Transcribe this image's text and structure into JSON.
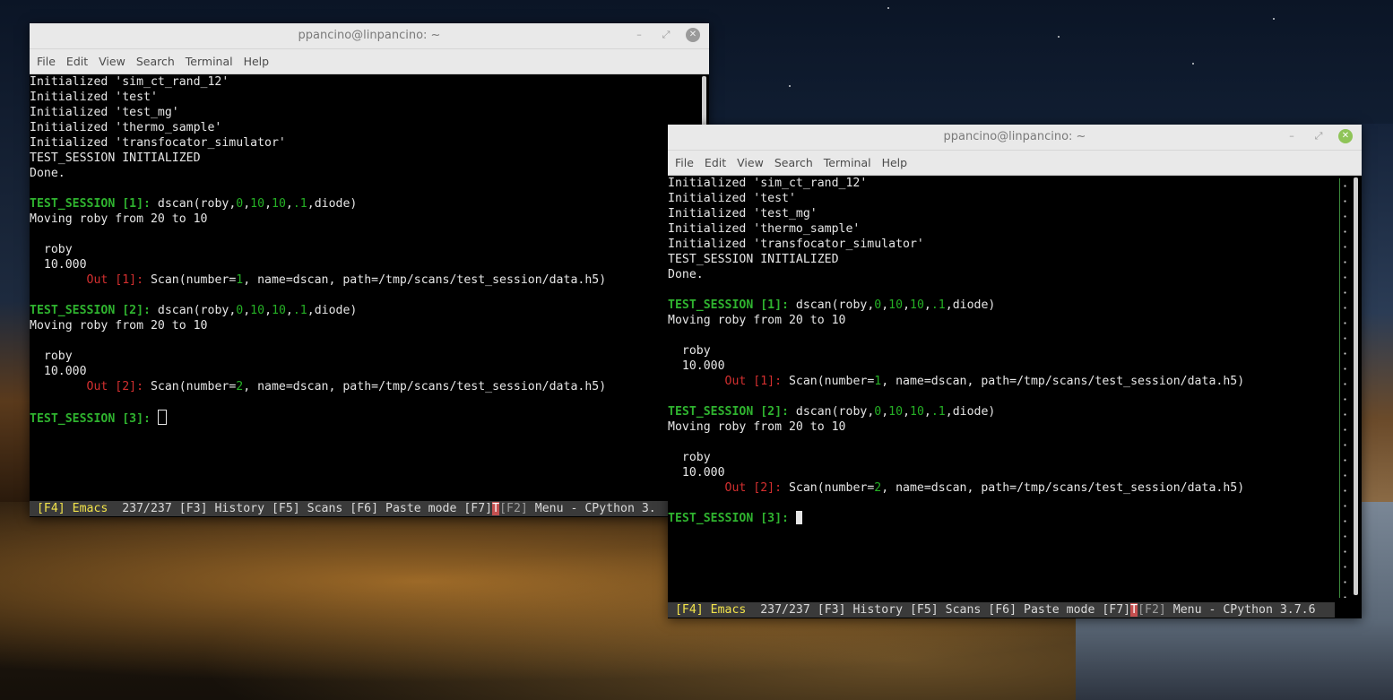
{
  "desktop": {
    "description_icons": []
  },
  "window_left": {
    "title": "ppancino@linpancino: ~",
    "menu": [
      "File",
      "Edit",
      "View",
      "Search",
      "Terminal",
      "Help"
    ],
    "lines": [
      "Initialized 'sim_ct_rand_12'",
      "Initialized 'test'",
      "Initialized 'test_mg'",
      "Initialized 'thermo_sample'",
      "Initialized 'transfocator_simulator'",
      "TEST_SESSION INITIALIZED",
      "Done.",
      "",
      "",
      "Moving roby from 20 to 10",
      "",
      "  roby",
      "  10.000",
      "",
      "",
      "",
      "Moving roby from 20 to 10",
      "",
      "  roby",
      "  10.000",
      "",
      "",
      ""
    ],
    "prompt1": "TEST_SESSION [1]: ",
    "prompt2": "TEST_SESSION [2]: ",
    "prompt3": "TEST_SESSION [3]: ",
    "cmd_pre": "dscan(roby,",
    "cmd_n1": "0",
    "cmd_c1": ",",
    "cmd_n2": "10",
    "cmd_c2": ",",
    "cmd_n3": "10",
    "cmd_c3": ",",
    "cmd_n4": ".1",
    "cmd_post": ",diode)",
    "out1_label": "        Out [1]: ",
    "out2_label": "        Out [2]: ",
    "out_pre": "Scan(number=",
    "out1_num": "1",
    "out2_num": "2",
    "out_post": ", name=dscan, path=/tmp/scans/test_session/data.h5)",
    "status": {
      "f4": "[F4] Emacs",
      "mid": "  237/237 [F3] History [F5] Scans [F6] Paste mode [F7]",
      "t": "T",
      "f2": "[F2]",
      "tail": " Menu - CPython 3."
    }
  },
  "window_right": {
    "title": "ppancino@linpancino: ~",
    "menu": [
      "File",
      "Edit",
      "View",
      "Search",
      "Terminal",
      "Help"
    ],
    "status_tail": " Menu - CPython 3.7.6"
  }
}
